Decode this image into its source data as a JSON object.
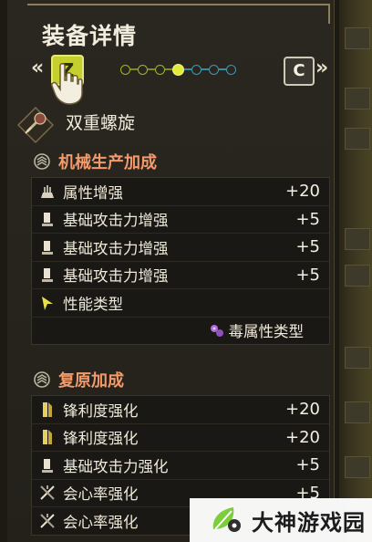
{
  "header": {
    "title": "装备详情",
    "nav_left_glyph": "«",
    "nav_right_glyph": "»",
    "prev_key": "Z",
    "next_key": "C",
    "page_count": 7,
    "active_page": 4
  },
  "weapon": {
    "name": "双重螺旋",
    "icon": "insect-glaive-icon"
  },
  "sections": [
    {
      "title": "机械生产加成",
      "icon": "gear-stack-icon",
      "rows": [
        {
          "icon": "element-boost-icon",
          "label": "属性增强",
          "value": "+20"
        },
        {
          "icon": "attack-boost-icon",
          "label": "基础攻击力增强",
          "value": "+5"
        },
        {
          "icon": "attack-boost-icon",
          "label": "基础攻击力增强",
          "value": "+5"
        },
        {
          "icon": "attack-boost-icon",
          "label": "基础攻击力增强",
          "value": "+5"
        },
        {
          "icon": "performance-type-icon",
          "label": "性能类型",
          "value": ""
        },
        {
          "icon": "poison-icon",
          "label": "毒属性类型",
          "value": "",
          "sub": true
        }
      ]
    },
    {
      "title": "复原加成",
      "icon": "gear-stack-icon",
      "rows": [
        {
          "icon": "sharpness-icon",
          "label": "锋利度强化",
          "value": "+20"
        },
        {
          "icon": "sharpness-icon",
          "label": "锋利度强化",
          "value": "+20"
        },
        {
          "icon": "attack-boost-icon",
          "label": "基础攻击力强化",
          "value": "+5"
        },
        {
          "icon": "affinity-icon",
          "label": "会心率强化",
          "value": "+5"
        },
        {
          "icon": "affinity-icon",
          "label": "会心率强化",
          "value": ""
        }
      ]
    }
  ],
  "watermark": {
    "text": "大神游戏园",
    "icon": "gamepad-leaf-icon"
  },
  "colors": {
    "section_title": "#f29a6c",
    "active_dot": "#e4ea3c",
    "prev_key_bg": "#c5cf2e"
  }
}
